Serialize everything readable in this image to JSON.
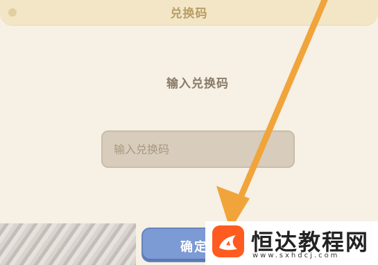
{
  "dialog": {
    "title": "兑换码",
    "prompt": "输入兑换码",
    "input": {
      "placeholder": "输入兑换码",
      "value": ""
    },
    "confirm_label": "确定"
  },
  "watermark": {
    "name": "恒达教程网",
    "url": "www.sxhdcj.com"
  },
  "colors": {
    "title_bar": "#f2e6c6",
    "background": "#f6f0e5",
    "input_bg": "#d8ccbc",
    "confirm_button": "#7c9ad4",
    "arrow": "#f0a43a",
    "logo": "#ff5a1f"
  }
}
